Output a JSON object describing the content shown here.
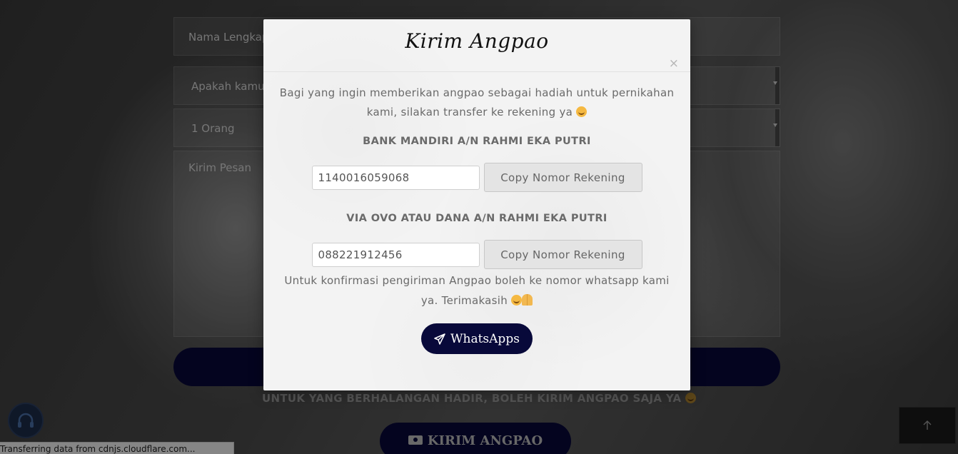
{
  "background_form": {
    "name_placeholder": "Nama Lengkap",
    "attend_placeholder": "Apakah kamu",
    "guest_count": "1 Orang",
    "message_placeholder": "Kirim Pesan",
    "note": "UNTUK YANG BERHALANGAN HADIR, BOLEH KIRIM ANGPAO SAJA YA",
    "angpao_button_label": "KIRIM ANGPAO"
  },
  "modal": {
    "title": "Kirim Angpao",
    "close_label": "×",
    "intro": "Bagi yang ingin memberikan angpao sebagai hadiah untuk pernikahan kami, silakan transfer ke rekening ya",
    "accounts": [
      {
        "title": "BANK MANDIRI A/N RAHMI EKA PUTRI",
        "number": "1140016059068",
        "copy_label": "Copy Nomor Rekening"
      },
      {
        "title": "VIA OVO ATAU DANA A/N RAHMI EKA PUTRI",
        "number": "088221912456",
        "copy_label": "Copy Nomor Rekening"
      }
    ],
    "confirm_text": "Untuk konfirmasi pengiriman Angpao boleh ke nomor whatsapp kami ya. Terimakasih",
    "whatsapp_label": "WhatsApps"
  },
  "status_bar": {
    "text": "Transferring data from cdnjs.cloudflare.com..."
  },
  "colors": {
    "navy": "#08093a",
    "modal_bg": "#f3f3f3",
    "text_gray": "#6a6a6a"
  },
  "icons": {
    "close": "close-icon",
    "send": "paper-plane-icon",
    "money": "money-icon",
    "music": "headphones-icon",
    "back_to_top": "arrow-up-icon"
  }
}
